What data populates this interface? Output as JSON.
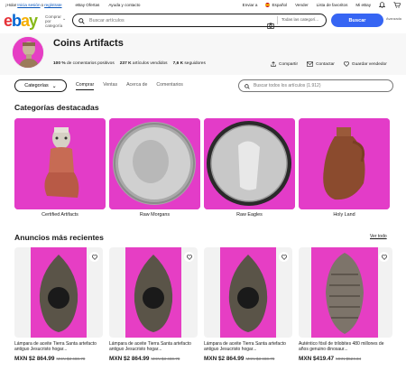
{
  "topbar": {
    "greeting": "¡Hola!",
    "signin": "Inicia sesión",
    "or": "o",
    "register": "regístrate",
    "deals": "eBay Ofertas",
    "help": "Ayuda y contacto",
    "ship_to": "Enviar a",
    "language": "Español",
    "sell": "Vender",
    "watchlist": "Lista de favoritos",
    "myebay": "Mi eBay"
  },
  "header": {
    "logo": {
      "e": "e",
      "b": "b",
      "a": "a",
      "y": "y"
    },
    "shop_by_category": "Comprar por categoría",
    "search_placeholder": "Buscar artículos",
    "category_select": "Todas las categorí...",
    "search_button": "Buscar",
    "advanced": "Avanzada"
  },
  "store": {
    "name": "Coins Artifacts",
    "positive_pct": "100 %",
    "positive_label": "de comentarios positivos",
    "sold_count": "237 K",
    "sold_label": "artículos vendidos",
    "followers_count": "7,6 K",
    "followers_label": "seguidores",
    "share": "Compartir",
    "contact": "Contactar",
    "save_seller": "Guardar vendedor"
  },
  "storenav": {
    "categories_button": "Categorías",
    "tabs": [
      "Comprar",
      "Ventas",
      "Acerca de",
      "Comentarios"
    ],
    "active_tab": "Comprar",
    "search_placeholder": "Buscar todos los artículos (1.912)"
  },
  "featured": {
    "heading": "Categorías destacadas",
    "items": [
      {
        "label": "Certified Artifacts"
      },
      {
        "label": "Raw Morgans"
      },
      {
        "label": "Raw Eagles"
      },
      {
        "label": "Holy Land"
      }
    ]
  },
  "recent": {
    "heading": "Anuncios más recientes",
    "see_all": "Ver todo",
    "items": [
      {
        "title": "Lámpara de aceite Tierra Santa artefacto antiguo Jesucristo hogar...",
        "price": "MXN $2 864.99",
        "was": "MXN $3 480.78"
      },
      {
        "title": "Lámpara de aceite Tierra Santa artefacto antiguo Jesucristo hogar...",
        "price": "MXN $2 864.99",
        "was": "MXN $3 480.78"
      },
      {
        "title": "Lámpara de aceite Tierra Santa artefacto antiguo Jesucristo hogar...",
        "price": "MXN $2 864.99",
        "was": "MXN $3 480.78"
      },
      {
        "title": "Auténtico fósil de trilobites 480 millones de años genuino dinosaur...",
        "price": "MXN $419.47",
        "was": "MXN $524.34"
      }
    ]
  },
  "colors": {
    "accent": "#3665f3",
    "tile_bg": "#e33cc8",
    "link": "#0654ba"
  },
  "icons": [
    "search-icon",
    "camera-icon",
    "bell-icon",
    "cart-icon",
    "heart-icon",
    "share-icon",
    "mail-icon",
    "favorite-heart-icon",
    "flag-icon"
  ]
}
